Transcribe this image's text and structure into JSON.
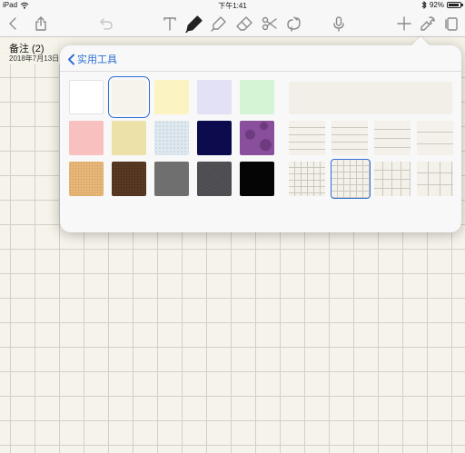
{
  "status_bar": {
    "device": "iPad",
    "time": "下午1:41",
    "battery": "92%",
    "battery_level": 0.92
  },
  "toolbar": {
    "left_icons": [
      "chevron-left-icon",
      "share-icon",
      "undo-icon"
    ],
    "tool_icons": [
      "text-tool-icon",
      "pen-icon",
      "highlighter-icon",
      "eraser-icon",
      "scissors-icon",
      "lasso-icon"
    ],
    "right_icons": [
      "microphone-icon",
      "plus-icon",
      "wrench-icon",
      "pages-icon"
    ],
    "active_tool": "pen-icon"
  },
  "note": {
    "title": "备注 (2)",
    "date": "2018年7月13日"
  },
  "popover": {
    "back_label": "实用工具",
    "colors": [
      {
        "name": "white",
        "color": "#ffffff"
      },
      {
        "name": "ivory",
        "color": "#f6f3ea",
        "selected": true
      },
      {
        "name": "pale-yellow",
        "color": "#fbf4c2"
      },
      {
        "name": "lavender",
        "color": "#e2e1f5"
      },
      {
        "name": "mint",
        "color": "#d4f4d6"
      },
      {
        "name": "pink",
        "color": "#f9c0c0"
      },
      {
        "name": "khaki",
        "color": "#ece1a8"
      },
      {
        "name": "light-blue-texture",
        "color": "#dfe8ee"
      },
      {
        "name": "navy",
        "color": "#0b0b4e"
      },
      {
        "name": "purple-dots",
        "color": "#8a4f9c"
      },
      {
        "name": "kraft",
        "color": "#e8b97c"
      },
      {
        "name": "brown",
        "color": "#5b3a24"
      },
      {
        "name": "gray",
        "color": "#6f6f6f"
      },
      {
        "name": "charcoal",
        "color": "#4a4a4f"
      },
      {
        "name": "black",
        "color": "#050505"
      }
    ],
    "paper_styles": [
      "blank",
      "lined-1",
      "lined-2",
      "lined-3",
      "lined-4",
      "grid-1",
      "grid-2",
      "grid-3",
      "grid-4"
    ],
    "selected_paper": "grid-2"
  }
}
